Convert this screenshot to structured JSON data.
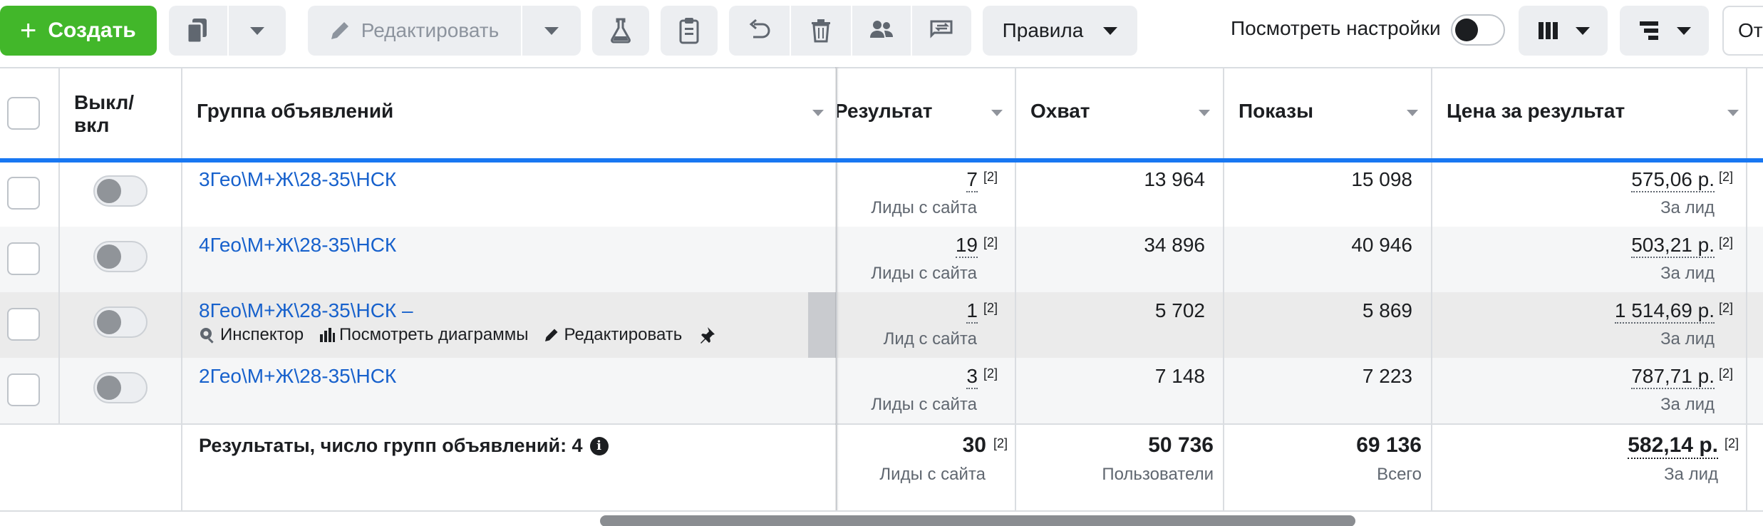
{
  "toolbar": {
    "create_label": "Создать",
    "edit_label": "Редактировать",
    "rules_label": "Правила",
    "view_settings_label": "Посмотреть настройки",
    "cut_text": "От"
  },
  "table": {
    "headers": {
      "toggle": "Выкл/ вкл",
      "name": "Группа объявлений",
      "result": "Результат",
      "reach": "Охват",
      "impressions": "Показы",
      "cost": "Цена за результат"
    },
    "rows": [
      {
        "name": "3Гео\\М+Ж\\28-35\\НСК",
        "result": "7",
        "result_ref": "[2]",
        "result_sub": "Лиды с сайта",
        "reach": "13 964",
        "impressions": "15 098",
        "cost": "575,06 р.",
        "cost_ref": "[2]",
        "cost_sub": "За лид"
      },
      {
        "name": "4Гео\\М+Ж\\28-35\\НСК",
        "result": "19",
        "result_ref": "[2]",
        "result_sub": "Лиды с сайта",
        "reach": "34 896",
        "impressions": "40 946",
        "cost": "503,21 р.",
        "cost_ref": "[2]",
        "cost_sub": "За лид"
      },
      {
        "name": "8Гео\\М+Ж\\28-35\\НСК –",
        "result": "1",
        "result_ref": "[2]",
        "result_sub": "Лид с сайта",
        "reach": "5 702",
        "impressions": "5 869",
        "cost": "1 514,69 р.",
        "cost_ref": "[2]",
        "cost_sub": "За лид",
        "actions": {
          "inspector": "Инспектор",
          "charts": "Посмотреть диаграммы",
          "edit": "Редактировать"
        }
      },
      {
        "name": "2Гео\\М+Ж\\28-35\\НСК",
        "result": "3",
        "result_ref": "[2]",
        "result_sub": "Лиды с сайта",
        "reach": "7 148",
        "impressions": "7 223",
        "cost": "787,71 р.",
        "cost_ref": "[2]",
        "cost_sub": "За лид"
      }
    ],
    "totals": {
      "label": "Результаты, число групп объявлений: 4",
      "result": "30",
      "result_ref": "[2]",
      "result_sub": "Лиды с сайта",
      "reach": "50 736",
      "reach_sub": "Пользователи",
      "impressions": "69 136",
      "impressions_sub": "Всего",
      "cost": "582,14 р.",
      "cost_ref": "[2]",
      "cost_sub": "За лид"
    }
  },
  "colors": {
    "create": "#42b72a",
    "link": "#1761cc",
    "accent": "#1877f2"
  }
}
